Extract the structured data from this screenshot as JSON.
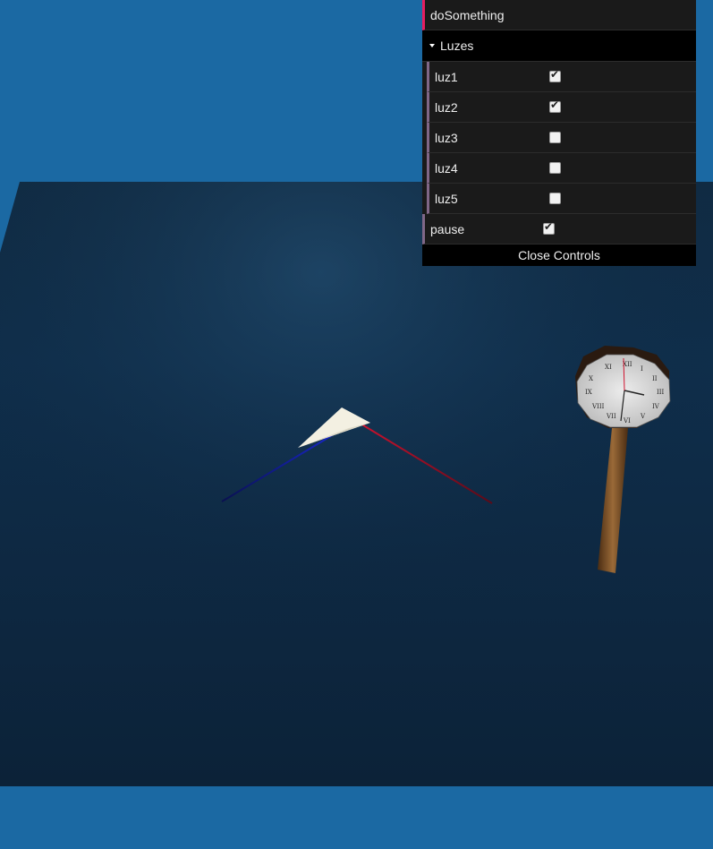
{
  "gui": {
    "do_something_label": "doSomething",
    "folder_title": "Luzes",
    "lights": [
      {
        "label": "luz1",
        "checked": true
      },
      {
        "label": "luz2",
        "checked": true
      },
      {
        "label": "luz3",
        "checked": false
      },
      {
        "label": "luz4",
        "checked": false
      },
      {
        "label": "luz5",
        "checked": false
      }
    ],
    "pause_label": "pause",
    "pause_checked": true,
    "close_label": "Close Controls"
  },
  "colors": {
    "background": "#1b69a3",
    "ocean_floor": "#0f2a42",
    "axis_x": "#c0102a",
    "axis_y": "#22c41e",
    "axis_z": "#1622c8",
    "gui_function_accent": "#e61d5f",
    "gui_boolean_accent": "#806787"
  }
}
